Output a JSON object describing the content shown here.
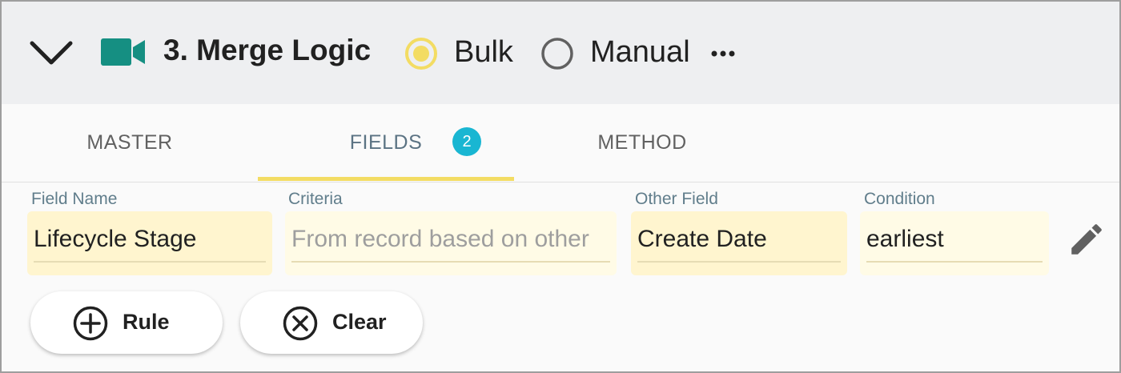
{
  "header": {
    "title": "3. Merge Logic",
    "collapse_icon": "chevron-down-icon",
    "step_icon": "video-camera-icon",
    "accent_color": "#158f82",
    "mode_options": [
      {
        "label": "Bulk",
        "selected": true
      },
      {
        "label": "Manual",
        "selected": false
      }
    ],
    "more_icon": "more-horizontal-icon"
  },
  "tabs": [
    {
      "label": "MASTER",
      "active": false
    },
    {
      "label": "FIELDS",
      "active": true,
      "badge": "2"
    },
    {
      "label": "METHOD",
      "active": false
    }
  ],
  "rule_row": {
    "field_name": {
      "label": "Field Name",
      "value": "Lifecycle Stage"
    },
    "criteria": {
      "label": "Criteria",
      "placeholder": "From record based on other"
    },
    "other_field": {
      "label": "Other Field",
      "value": "Create Date"
    },
    "condition": {
      "label": "Condition",
      "value": "earliest"
    },
    "edit_icon": "pencil-icon"
  },
  "actions": {
    "add_rule_label": "Rule",
    "add_rule_icon": "add-circle-icon",
    "clear_label": "Clear",
    "clear_icon": "cancel-circle-icon"
  },
  "colors": {
    "active_tab_underline": "#f3dc63",
    "badge": "#19b6d2",
    "radio_selected": "#f3dc63",
    "input_fill": "#fff5cf"
  }
}
